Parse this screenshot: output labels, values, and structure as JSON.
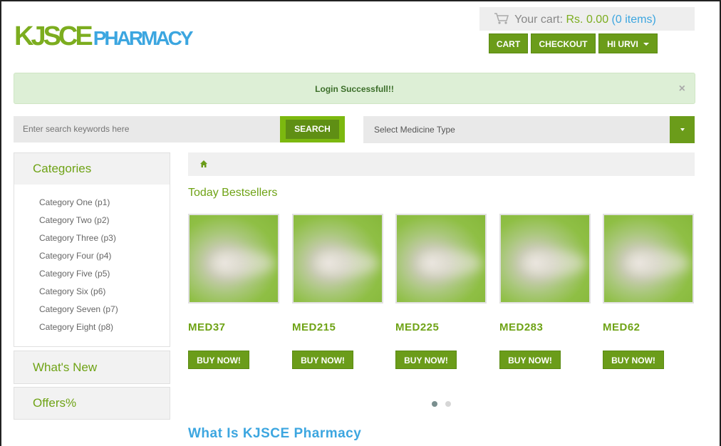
{
  "brand": {
    "logo_part1": "KJSCE",
    "logo_part2": "PHARMACY",
    "primary": "#6b9c1a",
    "accent": "#3ca6e0"
  },
  "cart": {
    "label": "Your cart:",
    "amount": "Rs. 0.00",
    "items": "(0 items)",
    "icon": "shopping-cart-icon"
  },
  "header_buttons": {
    "cart": "CART",
    "checkout": "CHECKOUT",
    "user": "HI URVI"
  },
  "alert": {
    "message": "Login Successfull!!",
    "close": "×"
  },
  "search": {
    "placeholder": "Enter search keywords here",
    "button": "SEARCH"
  },
  "medicine_select": {
    "selected": "Select Medicine Type"
  },
  "sidebar": {
    "categories_title": "Categories",
    "categories": [
      "Category One (p1)",
      "Category Two (p2)",
      "Category Three (p3)",
      "Category Four (p4)",
      "Category Five (p5)",
      "Category Six (p6)",
      "Category Seven (p7)",
      "Category Eight (p8)"
    ],
    "whats_new": "What's New",
    "offers": "Offers%"
  },
  "main": {
    "bestsellers_title": "Today Bestsellers",
    "products": [
      {
        "name": "MED37",
        "buy": "BUY NOW!"
      },
      {
        "name": "MED215",
        "buy": "BUY NOW!"
      },
      {
        "name": "MED225",
        "buy": "BUY NOW!"
      },
      {
        "name": "MED283",
        "buy": "BUY NOW!"
      },
      {
        "name": "MED62",
        "buy": "BUY NOW!"
      }
    ],
    "carousel_pages": 2,
    "carousel_active": 1,
    "about_title": "What Is KJSCE Pharmacy"
  }
}
